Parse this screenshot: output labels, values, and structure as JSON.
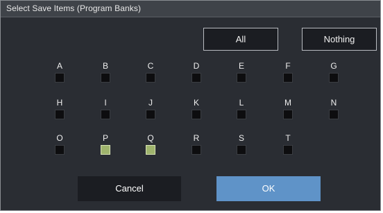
{
  "dialog": {
    "title": "Select Save Items (Program Banks)"
  },
  "buttons": {
    "all": "All",
    "nothing": "Nothing",
    "cancel": "Cancel",
    "ok": "OK"
  },
  "colors": {
    "checked": "#9fb46d",
    "ok_accent": "#5f93c8"
  },
  "banks": {
    "A": {
      "label": "A",
      "checked": false
    },
    "B": {
      "label": "B",
      "checked": false
    },
    "C": {
      "label": "C",
      "checked": false
    },
    "D": {
      "label": "D",
      "checked": false
    },
    "E": {
      "label": "E",
      "checked": false
    },
    "F": {
      "label": "F",
      "checked": false
    },
    "G": {
      "label": "G",
      "checked": false
    },
    "H": {
      "label": "H",
      "checked": false
    },
    "I": {
      "label": "I",
      "checked": false
    },
    "J": {
      "label": "J",
      "checked": false
    },
    "K": {
      "label": "K",
      "checked": false
    },
    "L": {
      "label": "L",
      "checked": false
    },
    "M": {
      "label": "M",
      "checked": false
    },
    "N": {
      "label": "N",
      "checked": false
    },
    "O": {
      "label": "O",
      "checked": false
    },
    "P": {
      "label": "P",
      "checked": true
    },
    "Q": {
      "label": "Q",
      "checked": true
    },
    "R": {
      "label": "R",
      "checked": false
    },
    "S": {
      "label": "S",
      "checked": false
    },
    "T": {
      "label": "T",
      "checked": false
    }
  }
}
